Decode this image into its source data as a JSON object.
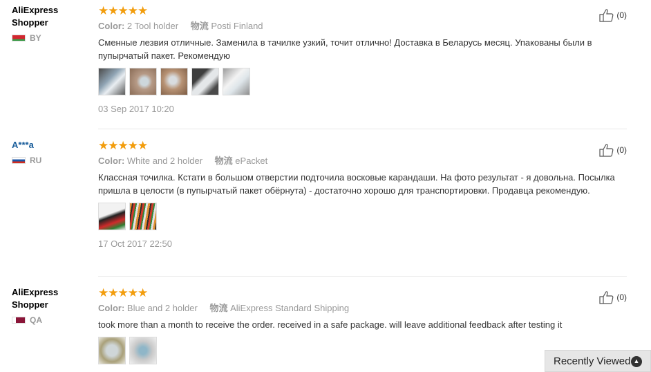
{
  "reviews": [
    {
      "user": "AliExpress Shopper",
      "country_code": "BY",
      "stars": "★★★★★",
      "color_label": "Color:",
      "color_value": "2 Tool holder",
      "shipping_label": "物流",
      "shipping_value": "Posti Finland",
      "text": "Сменные лезвия отличные. Заменила в тачилке узкий, точит отлично! Доставка в Беларусь месяц. Упакованы были в пупырчатый пакет. Рекомендую",
      "photo_count": 5,
      "date": "03 Sep 2017 10:20",
      "helpful": "(0)"
    },
    {
      "user": "A***a",
      "country_code": "RU",
      "stars": "★★★★★",
      "color_label": "Color:",
      "color_value": "White and 2 holder",
      "shipping_label": "物流",
      "shipping_value": "ePacket",
      "text": "Классная точилка. Кстати в большом отверстии подточила восковые карандаши. На фото результат - я довольна. Посылка пришла в целости (в пупырчатый пакет обёрнута) - достаточно хорошо для транспортировки. Продавца рекомендую.",
      "photo_count": 2,
      "date": "17 Oct 2017 22:50",
      "helpful": "(0)"
    },
    {
      "user": "AliExpress Shopper",
      "country_code": "QA",
      "stars": "★★★★★",
      "color_label": "Color:",
      "color_value": "Blue and 2 holder",
      "shipping_label": "物流",
      "shipping_value": "AliExpress Standard Shipping",
      "text": "took more than a month to receive the order. received in a safe package. will leave additional feedback after testing it",
      "photo_count": 2,
      "date": "",
      "helpful": "(0)"
    }
  ],
  "recently_viewed": {
    "label": "Recently Viewed",
    "icon": "chevron-up-icon"
  },
  "colors": {
    "star": "#f29d0d",
    "muted": "#999999",
    "link": "#1a5e9b"
  }
}
